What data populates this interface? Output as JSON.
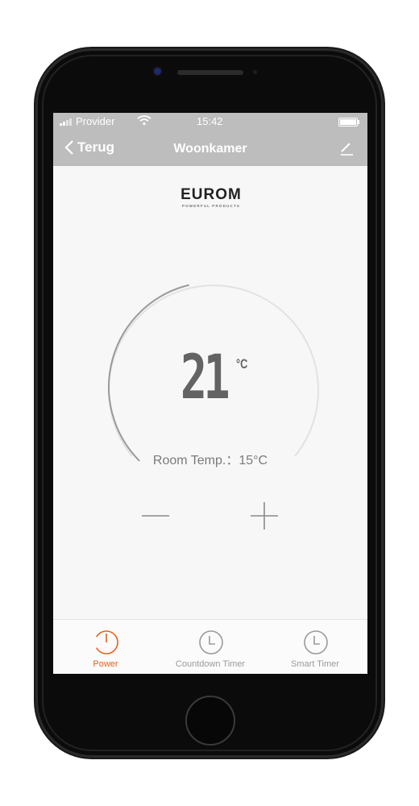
{
  "status_bar": {
    "carrier": "Provider",
    "time": "15:42"
  },
  "nav": {
    "back_label": "Terug",
    "title": "Woonkamer"
  },
  "logo": {
    "brand": "EUROM",
    "tagline": "POWERFUL PRODUCTS"
  },
  "thermostat": {
    "setpoint": "21",
    "unit": "°C",
    "room_temp_label": "Room Temp.：",
    "room_temp_value": "15°C",
    "arc_level": 0.45
  },
  "tabs": [
    {
      "label": "Power",
      "icon": "power-icon",
      "active": true
    },
    {
      "label": "Countdown Timer",
      "icon": "clock-icon",
      "active": false
    },
    {
      "label": "Smart Timer",
      "icon": "clock-icon",
      "active": false
    }
  ],
  "colors": {
    "accent": "#e8611c",
    "header": "#bdbdbd",
    "arc_active": "#9a9a9a",
    "arc_inactive": "#e2e2e2"
  }
}
